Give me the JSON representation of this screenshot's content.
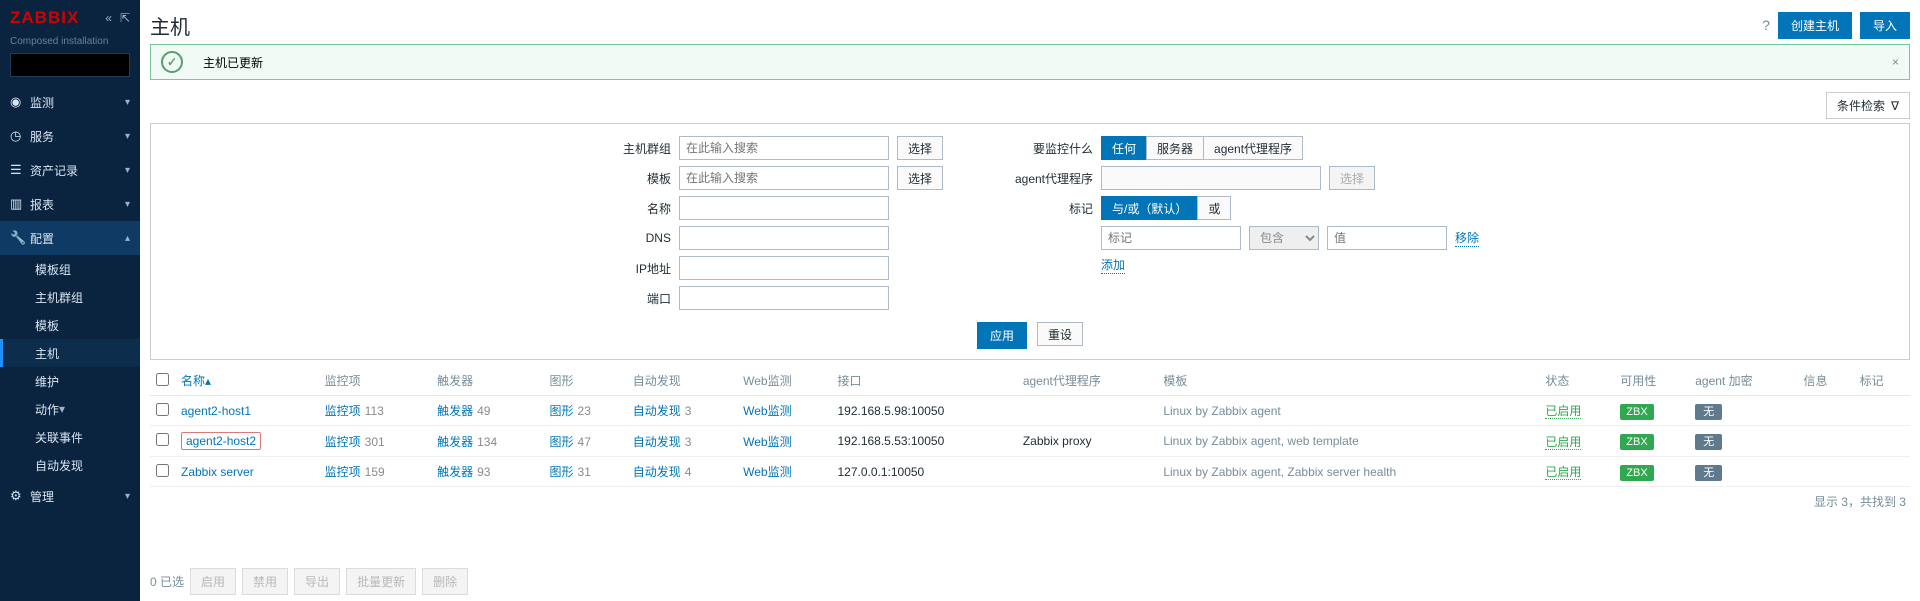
{
  "app": {
    "logo": "ZABBIX",
    "sub": "Composed installation"
  },
  "sidebar": {
    "items": [
      {
        "icon": "eye",
        "label": "监测"
      },
      {
        "icon": "clock",
        "label": "服务"
      },
      {
        "icon": "list",
        "label": "资产记录"
      },
      {
        "icon": "bar",
        "label": "报表"
      },
      {
        "icon": "wrench",
        "label": "配置"
      },
      {
        "icon": "gear",
        "label": "管理"
      }
    ],
    "config_sub": [
      "模板组",
      "主机群组",
      "模板",
      "主机",
      "维护",
      "动作",
      "关联事件",
      "自动发现"
    ]
  },
  "header": {
    "title": "主机",
    "create": "创建主机",
    "import": "导入"
  },
  "alert": {
    "msg": "主机已更新"
  },
  "filter": {
    "tab": "条件检索",
    "labels": {
      "hostgroup": "主机群组",
      "template": "模板",
      "name": "名称",
      "dns": "DNS",
      "ip": "IP地址",
      "port": "端口",
      "monitor": "要监控什么",
      "proxy": "agent代理程序",
      "tags": "标记"
    },
    "placeholder": "在此输入搜索",
    "select": "选择",
    "monitor_opts": [
      "任何",
      "服务器",
      "agent代理程序"
    ],
    "tag_mode": [
      "与/或（默认）",
      "或"
    ],
    "tag_row": {
      "ph": "标记",
      "op": "包含",
      "val_ph": "值",
      "remove": "移除"
    },
    "add": "添加",
    "apply": "应用",
    "reset": "重设"
  },
  "table": {
    "cols": [
      "名称",
      "监控项",
      "触发器",
      "图形",
      "自动发现",
      "Web监测",
      "接口",
      "agent代理程序",
      "模板",
      "状态",
      "可用性",
      "agent 加密",
      "信息",
      "标记"
    ],
    "rows": [
      {
        "name": "agent2-host1",
        "items": "113",
        "triggers": "49",
        "graphs": "23",
        "disc": "3",
        "web": "",
        "iface": "192.168.5.98:10050",
        "proxy": "",
        "tmpl": "Linux by Zabbix agent",
        "status": "已启用",
        "avail": "ZBX",
        "enc": "无"
      },
      {
        "name": "agent2-host2",
        "items": "301",
        "triggers": "134",
        "graphs": "47",
        "disc": "3",
        "web": "",
        "iface": "192.168.5.53:10050",
        "proxy": "Zabbix proxy",
        "tmpl": "Linux by Zabbix agent, web template",
        "status": "已启用",
        "avail": "ZBX",
        "enc": "无",
        "hl": true
      },
      {
        "name": "Zabbix server",
        "items": "159",
        "triggers": "93",
        "graphs": "31",
        "disc": "4",
        "web": "",
        "iface": "127.0.0.1:10050",
        "proxy": "",
        "tmpl": "Linux by Zabbix agent, Zabbix server health",
        "status": "已启用",
        "avail": "ZBX",
        "enc": "无"
      }
    ],
    "link_labels": {
      "items": "监控项",
      "triggers": "触发器",
      "graphs": "图形",
      "disc": "自动发现",
      "web": "Web监测"
    },
    "summary": "显示 3，共找到 3"
  },
  "bulk": {
    "sel": "0 已选",
    "btns": [
      "启用",
      "禁用",
      "导出",
      "批量更新",
      "删除"
    ]
  }
}
